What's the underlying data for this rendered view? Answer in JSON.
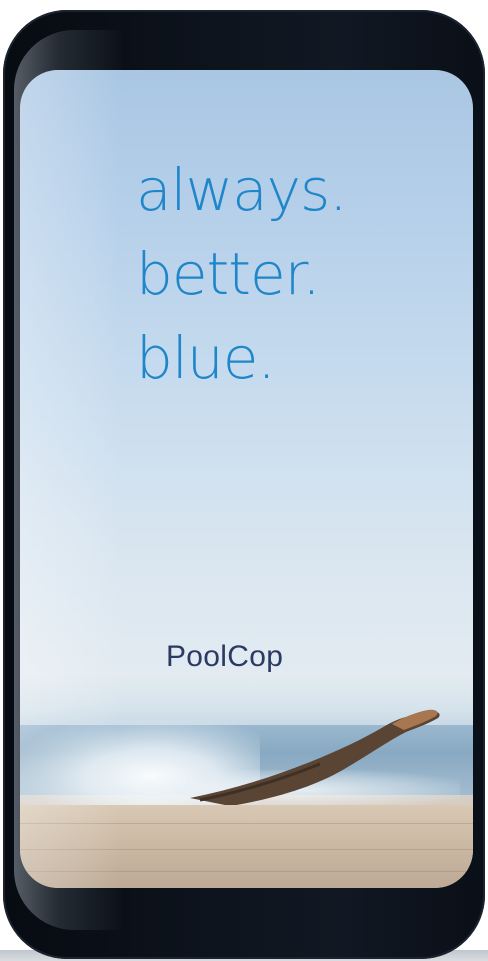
{
  "screen": {
    "tagline_lines": [
      "always.",
      "better.",
      "blue."
    ],
    "brand_name": "PoolCop"
  },
  "colors": {
    "tagline": "#1f86c9",
    "brand": "#2b3a64",
    "phone_frame": "#0d131c",
    "sky_top": "#a9c6e3",
    "deck": "#cdbba6"
  },
  "icons": {
    "device": "smartphone-icon",
    "photo": "diver-splash-photo"
  }
}
